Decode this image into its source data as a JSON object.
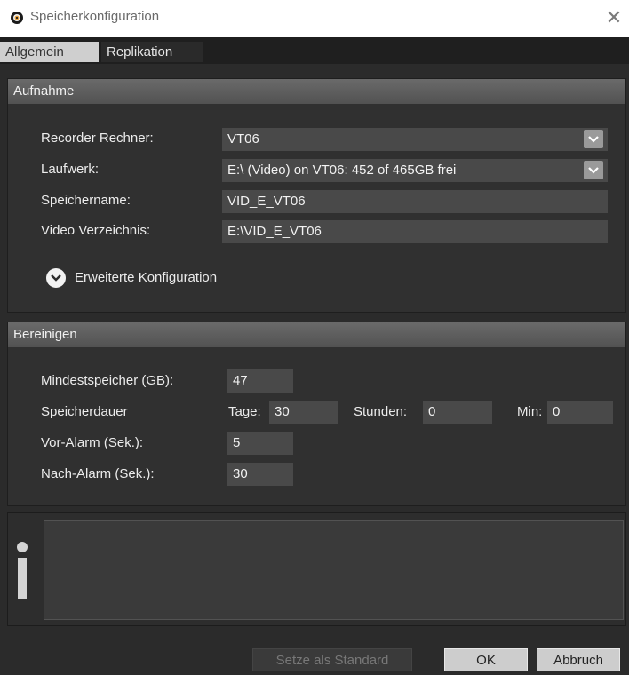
{
  "window": {
    "title": "Speicherkonfiguration",
    "close_glyph": "✕"
  },
  "tabs": [
    {
      "label": "Allgemein",
      "active": true
    },
    {
      "label": "Replikation",
      "active": false
    }
  ],
  "aufnahme": {
    "header": "Aufnahme",
    "recorder_label": "Recorder Rechner:",
    "recorder_value": "VT06",
    "laufwerk_label": "Laufwerk:",
    "laufwerk_value": "E:\\ (Video) on VT06: 452 of 465GB frei",
    "speichername_label": "Speichername:",
    "speichername_value": "VID_E_VT06",
    "verzeichnis_label": "Video Verzeichnis:",
    "verzeichnis_value": "E:\\VID_E_VT06",
    "erweitert_label": "Erweiterte Konfiguration"
  },
  "bereinigen": {
    "header": "Bereinigen",
    "mindest_label": "Mindestspeicher (GB):",
    "mindest_value": "47",
    "dauer_label": "Speicherdauer",
    "tage_label": "Tage:",
    "tage_value": "30",
    "stunden_label": "Stunden:",
    "stunden_value": "0",
    "min_label": "Min:",
    "min_value": "0",
    "vor_label": "Vor-Alarm (Sek.):",
    "vor_value": "5",
    "nach_label": "Nach-Alarm (Sek.):",
    "nach_value": "30"
  },
  "footer": {
    "standard_label": "Setze als Standard",
    "ok_label": "OK",
    "abbruch_label": "Abbruch"
  },
  "colors": {
    "background": "#2b2b2b",
    "panel_header": "#5e5e5e",
    "field": "#494949",
    "tab_active": "#cfcfcf"
  },
  "icons": {
    "app": "camera-lens-icon",
    "dropdown": "chevron-down-icon",
    "expander": "chevron-down-circle-icon",
    "info": "info-icon",
    "close": "close-icon"
  }
}
